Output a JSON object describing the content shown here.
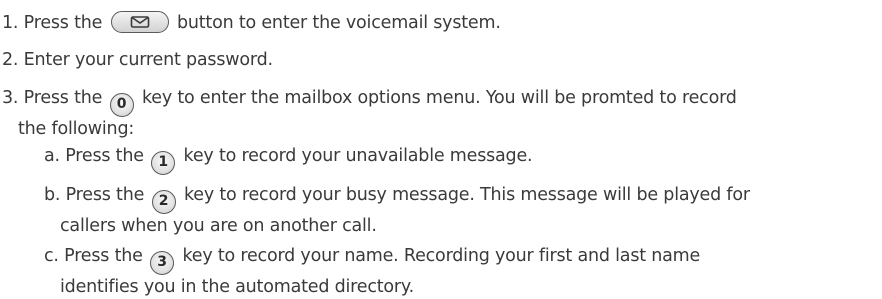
{
  "steps": [
    {
      "before": "1. Press the",
      "icon": "voicemail-button",
      "after": "button to enter the voicemail system."
    },
    {
      "text": "2. Enter your current password."
    },
    {
      "before": "3. Press the",
      "key": "0",
      "after": "key to enter the mailbox options menu. You will be promted to record",
      "continuation": "the following:"
    }
  ],
  "substeps": [
    {
      "before": "a. Press the",
      "key": "1",
      "after": "key to record your unavailable message."
    },
    {
      "before": "b. Press the",
      "key": "2",
      "after": "key to record your busy message. This message will be played for",
      "continuation": "callers when you are on another call."
    },
    {
      "before": "c. Press the",
      "key": "3",
      "after": "key to record your name. Recording your first and last name",
      "continuation": "identifies you in the automated directory."
    }
  ],
  "colors": {
    "text": "#3a3a3a",
    "key_border": "#5a5a5a"
  }
}
